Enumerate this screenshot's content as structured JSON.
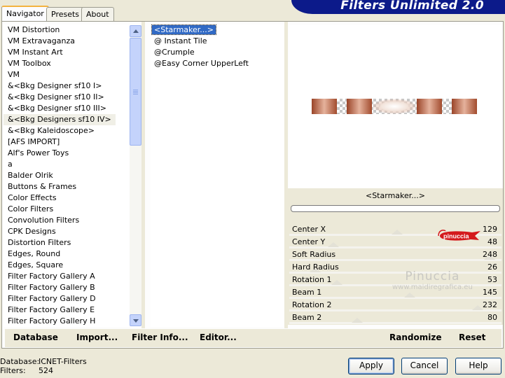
{
  "app": {
    "title": "Filters Unlimited 2.0"
  },
  "tabs": [
    {
      "label": "Navigator"
    },
    {
      "label": "Presets"
    },
    {
      "label": "About"
    }
  ],
  "categories": [
    "VM Distortion",
    "VM Extravaganza",
    "VM Instant Art",
    "VM Toolbox",
    "VM",
    "&<Bkg Designer sf10 I>",
    "&<Bkg Designer sf10 II>",
    "&<Bkg Designer sf10 III>",
    "&<Bkg Designers sf10 IV>",
    "&<Bkg Kaleidoscope>",
    "[AFS IMPORT]",
    "Alf's Power Toys",
    "a",
    "Balder Olrik",
    "Buttons & Frames",
    "Color Effects",
    "Color Filters",
    "Convolution Filters",
    "CPK Designs",
    "Distortion Filters",
    "Edges, Round",
    "Edges, Square",
    "Filter Factory Gallery A",
    "Filter Factory Gallery B",
    "Filter Factory Gallery D",
    "Filter Factory Gallery E",
    "Filter Factory Gallery H"
  ],
  "selected_category": "&<Bkg Designers sf10 IV>",
  "filters": [
    "<Starmaker...>",
    "@ Instant Tile",
    "@Crumple",
    "@Easy Corner UpperLeft"
  ],
  "selected_filter": "<Starmaker...>",
  "preset_name": "<Starmaker...>",
  "params": [
    {
      "name": "Center X",
      "value": "129"
    },
    {
      "name": "Center Y",
      "value": "48"
    },
    {
      "name": "Soft Radius",
      "value": "248"
    },
    {
      "name": "Hard Radius",
      "value": "26"
    },
    {
      "name": "Rotation 1",
      "value": "53"
    },
    {
      "name": "Beam 1",
      "value": "145"
    },
    {
      "name": "Rotation 2",
      "value": "232"
    },
    {
      "name": "Beam 2",
      "value": "80"
    }
  ],
  "param_levels": [
    0.51,
    0.19,
    0.97,
    0.1,
    0.21,
    0.57,
    0.91,
    0.31
  ],
  "watermark": {
    "name": "Pinuccia",
    "url": "www.maidiregrafica.eu"
  },
  "badge_text": "pinuccia",
  "bottom": {
    "database": "Database",
    "import": "Import...",
    "filter_info": "Filter Info...",
    "editor": "Editor...",
    "randomize": "Randomize",
    "reset": "Reset"
  },
  "status": {
    "database_label": "Database:",
    "database_value": "ICNET-Filters",
    "filters_label": "Filters:",
    "filters_value": "524"
  },
  "buttons": {
    "apply": "Apply",
    "cancel": "Cancel",
    "help": "Help"
  },
  "colors": {
    "title_bar": "#0c1a8a",
    "selection": "#316ac5",
    "strip_copper": "#b05a3c",
    "badge_red": "#d4191c"
  }
}
